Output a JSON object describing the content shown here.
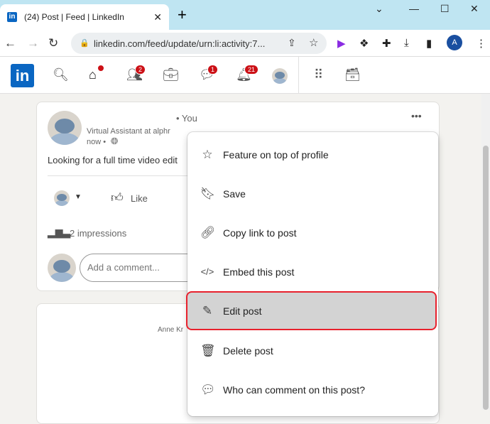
{
  "browser": {
    "tab_title": "(24) Post | Feed | LinkedIn",
    "favicon": "in",
    "url": "linkedin.com/feed/update/urn:li:activity:7...",
    "profile_initial": "A"
  },
  "linkedin": {
    "logo": "in",
    "badges": {
      "home": "",
      "network": "2",
      "messaging": "1",
      "notifications": "21"
    }
  },
  "post": {
    "author_suffix": "• You",
    "headline": "Virtual Assistant at alphr",
    "time": "now •",
    "text": "Looking for a full time video edit",
    "like": "Like",
    "impressions": "2 impressions",
    "comment_placeholder": "Add a comment...",
    "more": "•••"
  },
  "next_card": {
    "author": "Anne Kr"
  },
  "menu": {
    "items": [
      {
        "label": "Feature on top of profile",
        "icon": "star-icon"
      },
      {
        "label": "Save",
        "icon": "bookmark-icon"
      },
      {
        "label": "Copy link to post",
        "icon": "link-icon"
      },
      {
        "label": "Embed this post",
        "icon": "code-icon"
      },
      {
        "label": "Edit post",
        "icon": "pencil-icon",
        "highlighted": true
      },
      {
        "label": "Delete post",
        "icon": "trash-icon"
      },
      {
        "label": "Who can comment on this post?",
        "icon": "comment-icon"
      }
    ]
  },
  "colors": {
    "brand": "#0a66c2",
    "highlight_border": "#e8212d",
    "badge": "#cc1016"
  }
}
